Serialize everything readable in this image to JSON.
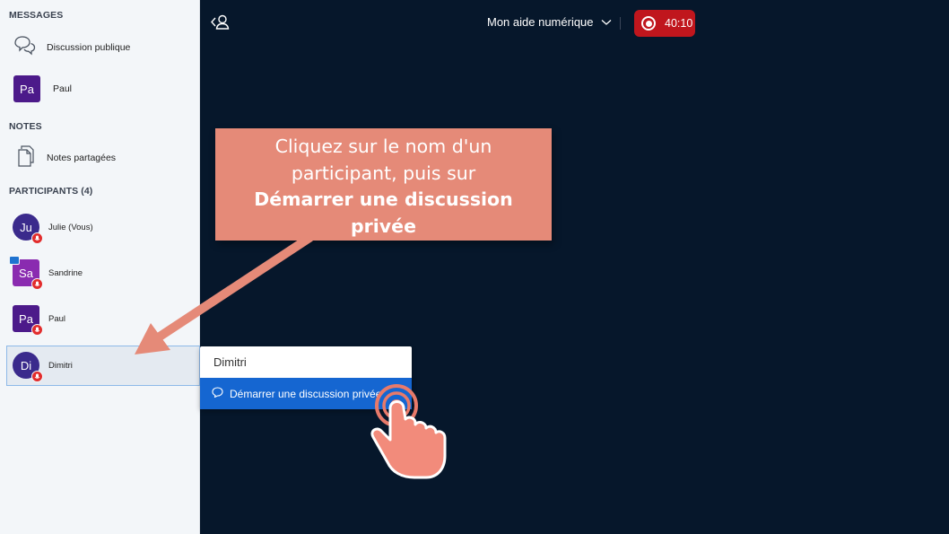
{
  "sidebar": {
    "messages_title": "MESSAGES",
    "public_chat_label": "Discussion publique",
    "private_chat": {
      "initials": "Pa",
      "name": "Paul",
      "color": "#4c1a8a"
    },
    "notes_title": "NOTES",
    "shared_notes_label": "Notes partagées",
    "participants_title": "PARTICIPANTS (4)",
    "participants": [
      {
        "initials": "Ju",
        "name": "Julie (Vous)",
        "color": "#3a2a8c"
      },
      {
        "initials": "Sa",
        "name": "Sandrine",
        "color": "#8a2bb0"
      },
      {
        "initials": "Pa",
        "name": "Paul",
        "color": "#4c1a8a"
      },
      {
        "initials": "Di",
        "name": "Dimitri",
        "color": "#3a2a8c"
      }
    ]
  },
  "topbar": {
    "room_title": "Mon aide numérique",
    "recording_time": "40:10",
    "recording_color": "#c0161d"
  },
  "callout": {
    "line1": "Cliquez sur le nom d'un",
    "line2": "participant, puis sur",
    "bold1": "Démarrer une discussion",
    "bold2": "privée",
    "color": "#e58a78"
  },
  "context_menu": {
    "participant_name": "Dimitri",
    "action_label": "Démarrer une discussion privée",
    "action_color": "#1566d1"
  },
  "icons": [
    "chat-bubbles-icon",
    "document-icon",
    "back-user-icon",
    "chevron-down-icon",
    "record-icon",
    "mic-muted-icon",
    "screen-share-icon",
    "chat-bubble-icon",
    "tap-hand-icon",
    "arrow-icon"
  ]
}
